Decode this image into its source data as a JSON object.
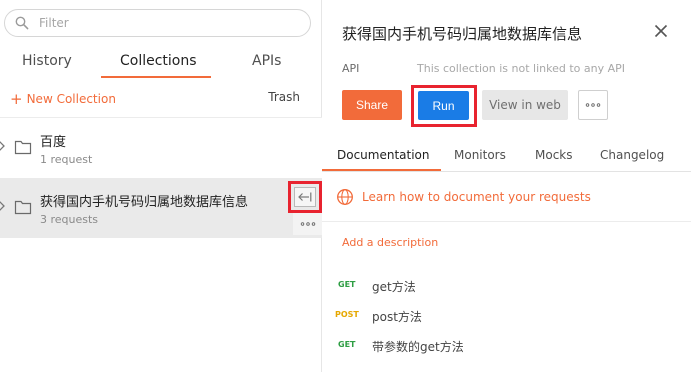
{
  "sidebar": {
    "search_placeholder": "Filter",
    "tabs": [
      {
        "label": "History"
      },
      {
        "label": "Collections"
      },
      {
        "label": "APIs"
      }
    ],
    "new_collection_label": "New Collection",
    "trash_label": "Trash",
    "collections": [
      {
        "name": "百度",
        "count": "1 request"
      },
      {
        "name": "获得国内手机号码归属地数据库信息",
        "count": "3 requests"
      }
    ]
  },
  "panel": {
    "title": "获得国内手机号码归属地数据库信息",
    "api_label": "API",
    "api_note": "This collection is not linked to any API",
    "share_label": "Share",
    "run_label": "Run",
    "view_web_label": "View in web",
    "tabs": [
      {
        "label": "Documentation"
      },
      {
        "label": "Monitors"
      },
      {
        "label": "Mocks"
      },
      {
        "label": "Changelog"
      }
    ],
    "learn_link": "Learn how to document your requests",
    "add_description": "Add a description",
    "requests": [
      {
        "method": "GET",
        "name": "get方法"
      },
      {
        "method": "POST",
        "name": "post方法"
      },
      {
        "method": "GET",
        "name": "带参数的get方法"
      }
    ]
  },
  "colors": {
    "accent": "#f26b3a",
    "run_blue": "#1a7ce6",
    "highlight_red": "#e8232f",
    "get_green": "#2f9e44",
    "post_yellow": "#e6a800"
  }
}
